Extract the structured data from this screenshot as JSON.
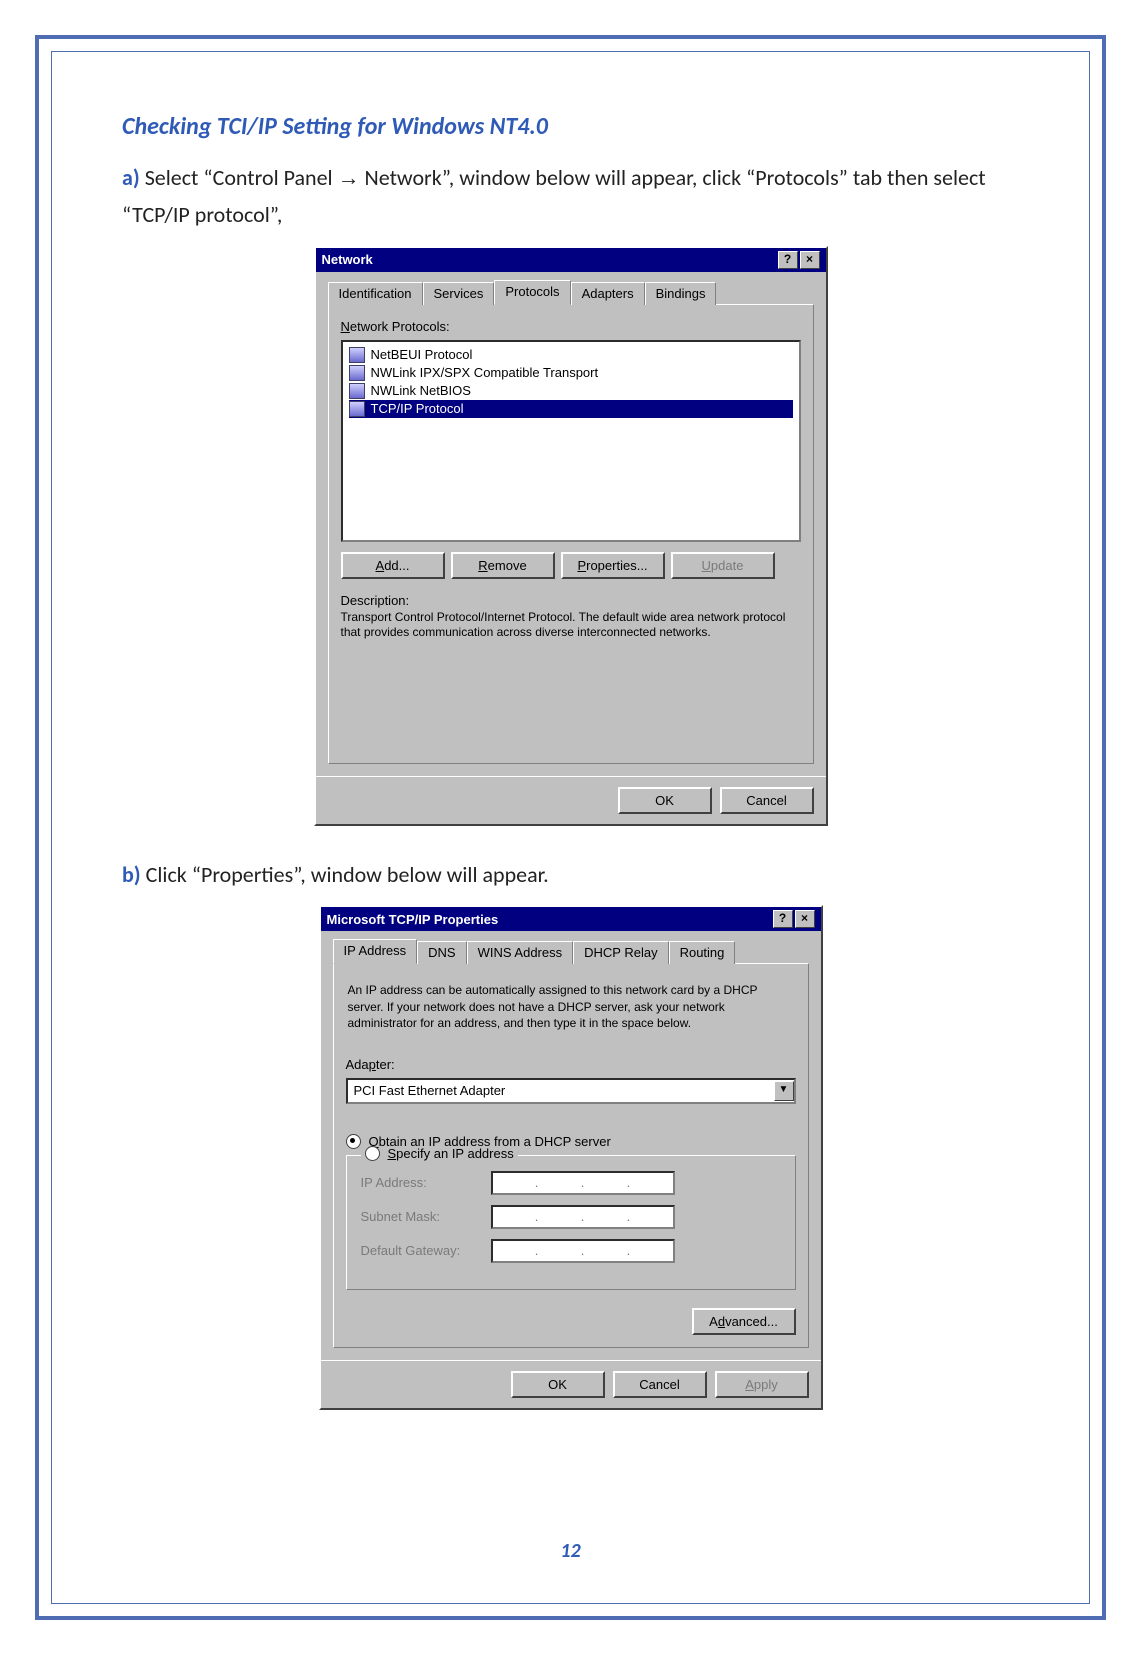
{
  "heading": "Checking TCI/IP Setting for Windows NT4.0",
  "step_a": {
    "marker": "a)",
    "text_before": "Select “Control Panel ",
    "arrow": "→",
    "text_after": " Network”, window below will appear, click “Protocols” tab then select “TCP/IP protocol”,"
  },
  "step_b": {
    "marker": "b)",
    "text": "Click “Properties”, window below will appear."
  },
  "dlg1": {
    "title": "Network",
    "tabs": [
      "Identification",
      "Services",
      "Protocols",
      "Adapters",
      "Bindings"
    ],
    "active_tab": 2,
    "list_label": "Network Protocols:",
    "protocols": [
      "NetBEUI Protocol",
      "NWLink IPX/SPX Compatible Transport",
      "NWLink NetBIOS",
      "TCP/IP Protocol"
    ],
    "selected": 3,
    "buttons": {
      "add": "Add...",
      "remove": "Remove",
      "props": "Properties...",
      "update": "Update"
    },
    "desc_label": "Description:",
    "desc": "Transport Control Protocol/Internet Protocol. The default wide area network protocol that provides communication across diverse interconnected networks.",
    "ok": "OK",
    "cancel": "Cancel"
  },
  "dlg2": {
    "title": "Microsoft TCP/IP Properties",
    "tabs": [
      "IP Address",
      "DNS",
      "WINS Address",
      "DHCP Relay",
      "Routing"
    ],
    "active_tab": 0,
    "intro": "An IP address can be automatically assigned to this network card by a DHCP server.  If your network does not have a DHCP server, ask your network administrator for an address, and then type it in the space below.",
    "adapter_label": "Adapter:",
    "adapter": "PCI Fast Ethernet Adapter",
    "radio_dhcp": "Obtain an IP address from a DHCP server",
    "radio_static": "Specify an IP address",
    "ip_label": "IP Address:",
    "mask_label": "Subnet Mask:",
    "gw_label": "Default Gateway:",
    "advanced": "Advanced...",
    "ok": "OK",
    "cancel": "Cancel",
    "apply": "Apply"
  },
  "page_number": "12"
}
